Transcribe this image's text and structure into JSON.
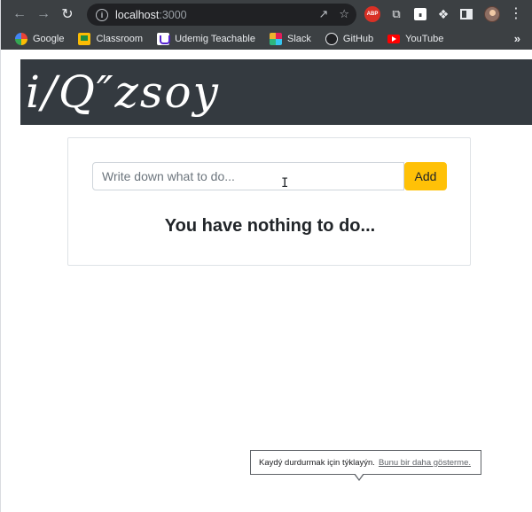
{
  "browser": {
    "url_host": "localhost",
    "url_port": ":3000",
    "colors": {
      "chrome": "#3c4043",
      "omnibox": "#202124"
    }
  },
  "bookmarks": [
    {
      "label": "Google",
      "icon": "google-icon"
    },
    {
      "label": "Classroom",
      "icon": "classroom-icon"
    },
    {
      "label": "Udemig Teachable",
      "icon": "teachable-icon"
    },
    {
      "label": "Slack",
      "icon": "slack-icon"
    },
    {
      "label": "GitHub",
      "icon": "github-icon"
    },
    {
      "label": "YouTube",
      "icon": "youtube-icon"
    }
  ],
  "extensions": {
    "abp_label": "ABP"
  },
  "app": {
    "logo": "i/Q″zsoy",
    "input_placeholder": "Write down what to do...",
    "add_label": "Add",
    "empty_message": "You have nothing to do...",
    "colors": {
      "banner": "#343a40",
      "add_button": "#ffc107"
    }
  },
  "tooltip": {
    "text": "Kaydý durdurmak için týklayýn.",
    "link": "Bunu bir daha gösterme."
  }
}
